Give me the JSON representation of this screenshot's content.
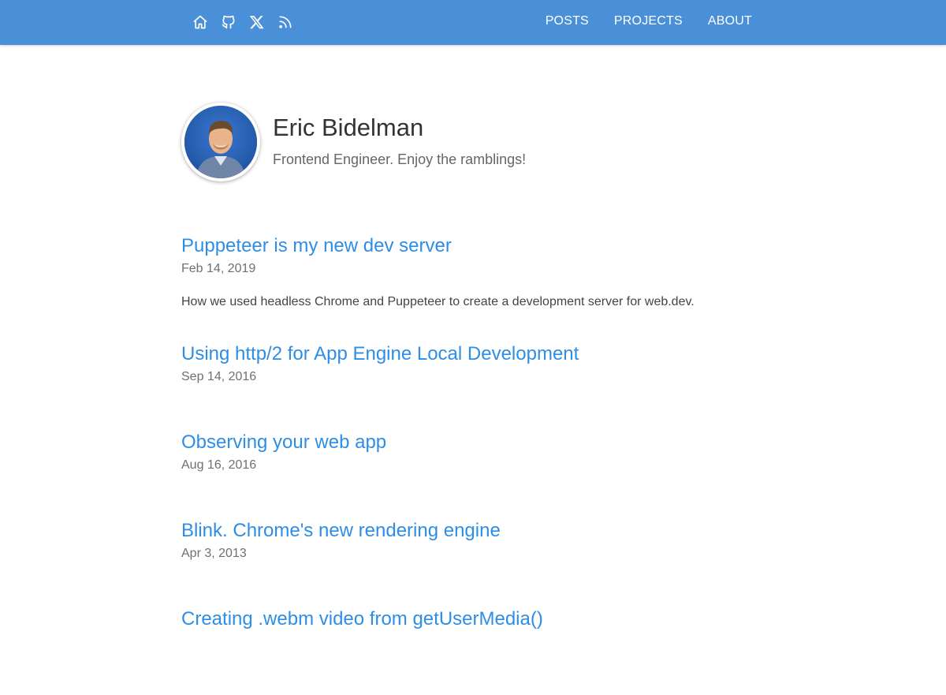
{
  "header": {
    "icons": [
      {
        "name": "home-icon"
      },
      {
        "name": "github-icon"
      },
      {
        "name": "x-twitter-icon"
      },
      {
        "name": "rss-icon"
      }
    ],
    "nav": [
      {
        "label": "POSTS"
      },
      {
        "label": "PROJECTS"
      },
      {
        "label": "ABOUT"
      }
    ],
    "background_color": "#4a90d9"
  },
  "profile": {
    "name": "Eric Bidelman",
    "tagline": "Frontend Engineer. Enjoy the ramblings!"
  },
  "posts": [
    {
      "title": "Puppeteer is my new dev server",
      "date": "Feb 14, 2019",
      "summary": "How we used headless Chrome and Puppeteer to create a development server for web.dev."
    },
    {
      "title": "Using http/2 for App Engine Local Development",
      "date": "Sep 14, 2016"
    },
    {
      "title": "Observing your web app",
      "date": "Aug 16, 2016"
    },
    {
      "title": "Blink. Chrome's new rendering engine",
      "date": "Apr 3, 2013"
    },
    {
      "title": "Creating .webm video from getUserMedia()",
      "date": ""
    }
  ],
  "colors": {
    "link": "#2e8ee6",
    "text": "#333333",
    "muted": "#707070"
  }
}
